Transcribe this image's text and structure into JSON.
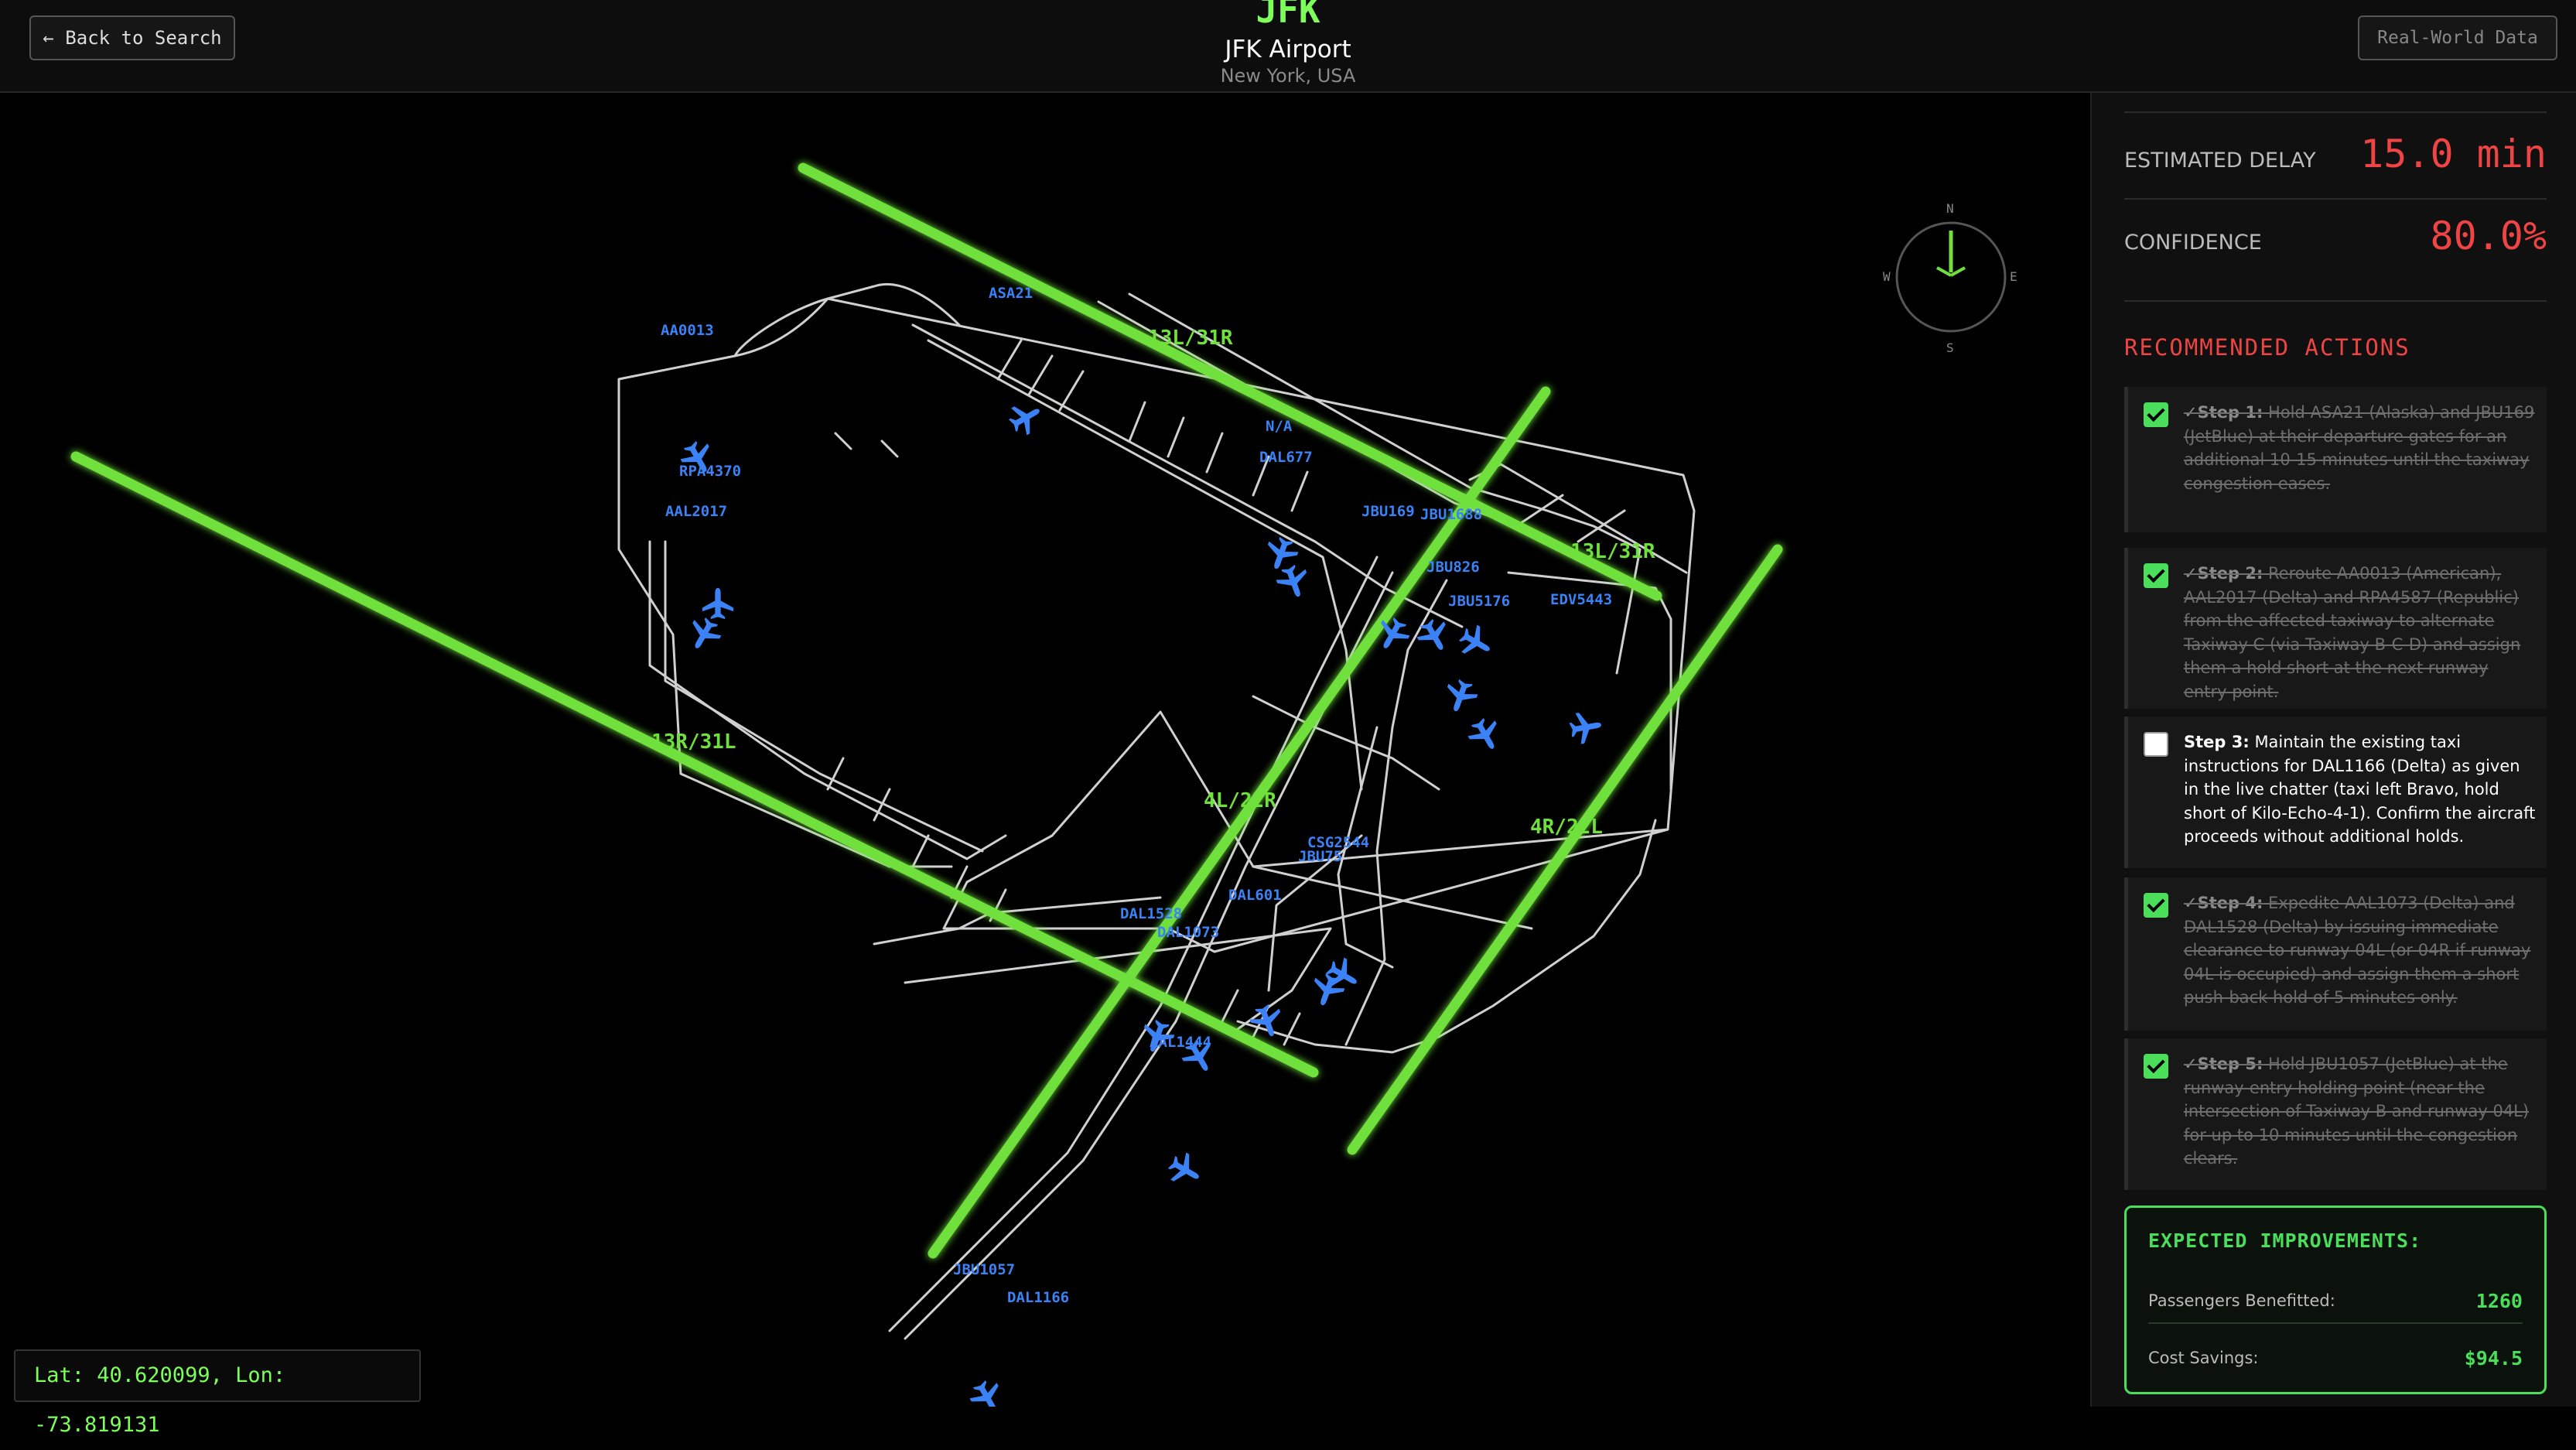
{
  "header": {
    "back_label": "← Back to Search",
    "code": "JFK",
    "name": "JFK Airport",
    "location": "New York, USA",
    "badge": "Real-World Data"
  },
  "map": {
    "runway_color": "#6fe03c",
    "aircraft_color": "#3b82f6",
    "runways": [
      "13L/31R",
      "13R/31L",
      "4L/22R",
      "4R/22L"
    ],
    "flights": [
      "AA0013",
      "ASA21",
      "RPA4370",
      "AAL2017",
      "N/A",
      "DAL677",
      "JBU169",
      "JBU826",
      "JBU1688",
      "JBU5176",
      "EDV5443",
      "CSG2544",
      "JBU75",
      "DAL601",
      "DAL1528",
      "DAL1073",
      "AAL1444",
      "JBU1057",
      "DAL1166"
    ],
    "compass": {
      "n": "N",
      "e": "E",
      "s": "S",
      "w": "W"
    },
    "coords": "Lat: 40.620099, Lon: -73.819131"
  },
  "panel": {
    "delay_label": "ESTIMATED DELAY",
    "delay_value": "15.0 min",
    "confidence_label": "CONFIDENCE",
    "confidence_value": "80.0%",
    "recommended_title": "RECOMMENDED ACTIONS",
    "steps": [
      {
        "head": "✓Step 1:",
        "body": " Hold ASA21 (Alaska) and JBU169 (JetBlue) at their departure gates for an additional 10-15 minutes until the taxiway congestion eases.",
        "checked": true
      },
      {
        "head": "✓Step 2:",
        "body": " Reroute AA0013 (American), AAL2017 (Delta) and RPA4587 (Republic) from the affected taxiway to alternate Taxiway C (via Taxiway B-C-D) and assign them a hold short at the next runway entry point.",
        "checked": true
      },
      {
        "head": "Step 3:",
        "body": " Maintain the existing taxi instructions for DAL1166 (Delta) as given in the live chatter (taxi left Bravo, hold short of Kilo-Echo-4-1). Confirm the aircraft proceeds without additional holds.",
        "checked": false
      },
      {
        "head": "✓Step 4:",
        "body": " Expedite AAL1073 (Delta) and DAL1528 (Delta) by issuing immediate clearance to runway 04L (or 04R if runway 04L is occupied) and assign them a short push-back hold of 5 minutes only.",
        "checked": true
      },
      {
        "head": "✓Step 5:",
        "body": " Hold JBU1057 (JetBlue) at the runway-entry holding point (near the intersection of Taxiway B and runway 04L) for up to 10 minutes until the congestion clears.",
        "checked": true
      }
    ],
    "improvements": {
      "title": "EXPECTED IMPROVEMENTS:",
      "passengers_label": "Passengers Benefitted:",
      "passengers_value": "1260",
      "cost_label": "Cost Savings:",
      "cost_value": "$94.5"
    }
  }
}
